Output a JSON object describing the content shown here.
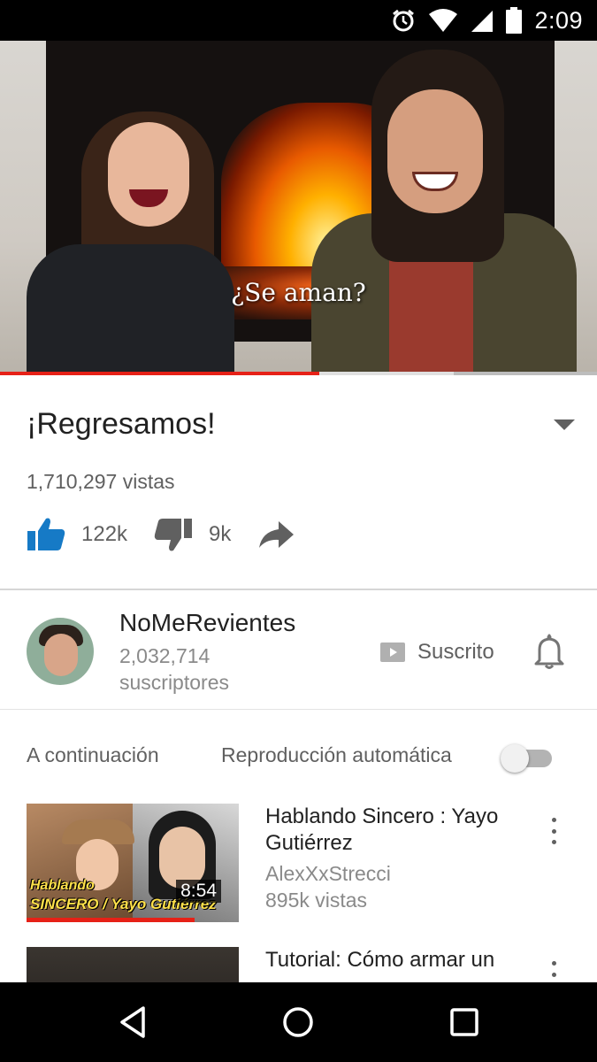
{
  "status_bar": {
    "time": "2:09",
    "icons": [
      "alarm-icon",
      "wifi-icon",
      "signal-icon",
      "battery-icon"
    ]
  },
  "player": {
    "subtitle": "¿Se aman?",
    "progress_percent": 53.5,
    "buffer_percent": 76
  },
  "video": {
    "title": "¡Regresamos!",
    "views": "1,710,297 vistas",
    "likes": "122k",
    "dislikes": "9k"
  },
  "channel": {
    "name": "NoMeRevientes",
    "subscriber_count": "2,032,714",
    "subscriber_label": "suscriptores",
    "subscribe_label": "Suscrito"
  },
  "up_next": {
    "label": "A continuación",
    "autoplay_label": "Reproducción automática",
    "autoplay_enabled": false,
    "items": [
      {
        "title": "Hablando Sincero : Yayo Gutiérrez",
        "channel": "AlexXxStrecci",
        "views": "895k vistas",
        "duration": "8:54",
        "thumb_text_1": "Hablando",
        "thumb_text_2": "SINCERO / Yayo Gutiérrez"
      },
      {
        "title": "Tutorial: Cómo armar un"
      }
    ]
  },
  "colors": {
    "accent": "#e62117",
    "like_active": "#167ac6",
    "text_primary": "#212121",
    "text_secondary": "#606060"
  }
}
